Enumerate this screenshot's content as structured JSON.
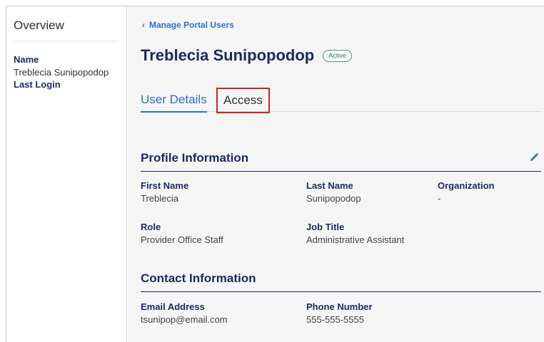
{
  "sidebar": {
    "title": "Overview",
    "name_label": "Name",
    "name_value": "Treblecia Sunipopodop",
    "last_login_label": "Last Login"
  },
  "header": {
    "back_link": "Manage Portal Users",
    "back_icon": "chevron-left-icon",
    "user_name": "Treblecia Sunipopodop",
    "status": "Active"
  },
  "tabs": [
    {
      "label": "User Details",
      "selected": true
    },
    {
      "label": "Access",
      "selected": false
    }
  ],
  "profile": {
    "title": "Profile Information",
    "edit_icon": "pencil-icon",
    "fields": {
      "first_name": {
        "label": "First Name",
        "value": "Treblecia"
      },
      "last_name": {
        "label": "Last Name",
        "value": "Sunipopodop"
      },
      "organization": {
        "label": "Organization",
        "value": "-"
      },
      "role": {
        "label": "Role",
        "value": "Provider Office Staff"
      },
      "job_title": {
        "label": "Job Title",
        "value": "Administrative Assistant"
      }
    }
  },
  "contact": {
    "title": "Contact Information",
    "fields": {
      "email": {
        "label": "Email Address",
        "value": "tsunipop@email.com"
      },
      "phone": {
        "label": "Phone Number",
        "value": "555-555-5555"
      }
    }
  },
  "colors": {
    "accent": "#2f72c4",
    "heading": "#1a2a5e",
    "highlight": "#c62828",
    "status": "#4a9a6a"
  }
}
